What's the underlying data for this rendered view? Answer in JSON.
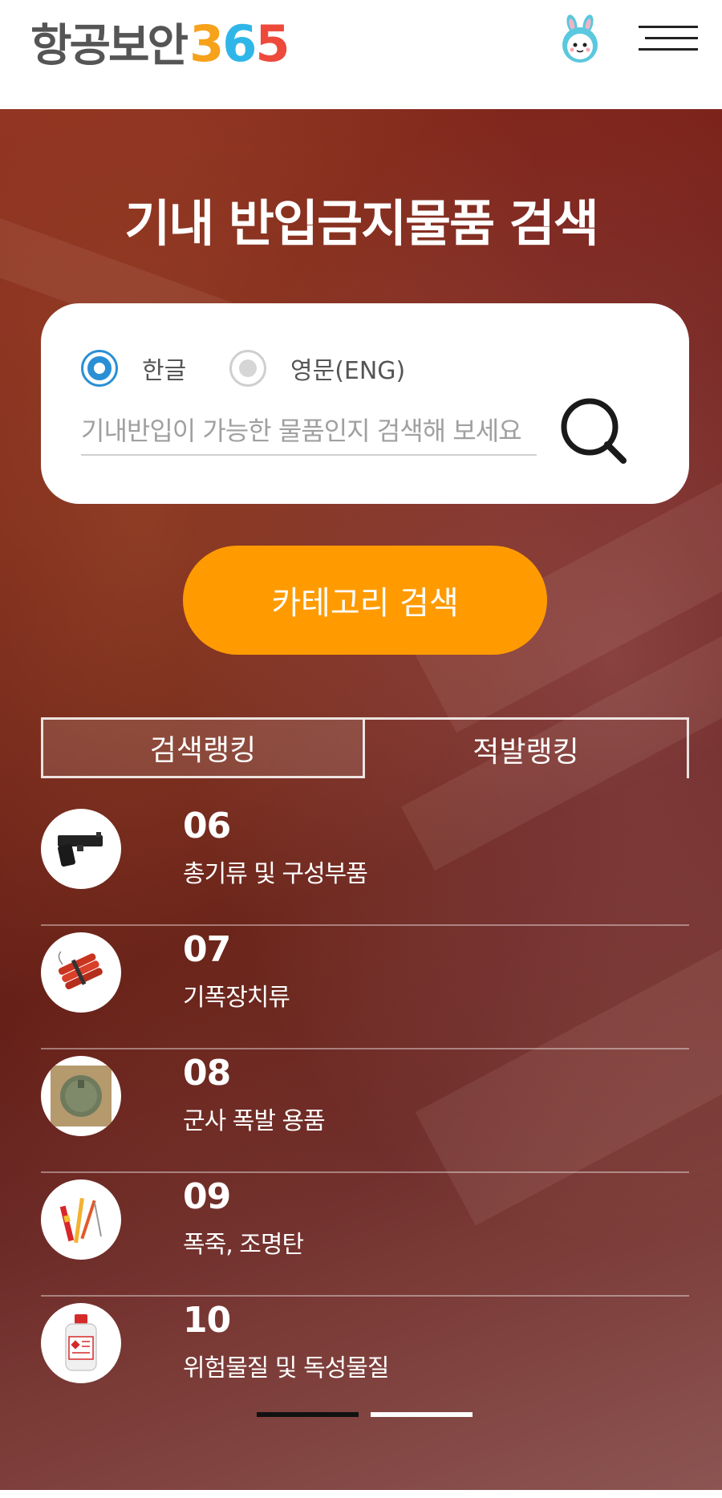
{
  "header": {
    "logo_text": "항공보안",
    "logo_number": [
      "3",
      "6",
      "5"
    ],
    "mascot_icon": "rabbit-mascot-icon",
    "menu_icon": "hamburger-menu-icon"
  },
  "hero": {
    "title": "기내 반입금지물품 검색"
  },
  "search": {
    "lang_options": [
      {
        "label": "한글",
        "selected": true
      },
      {
        "label": "영문(ENG)",
        "selected": false
      }
    ],
    "placeholder": "기내반입이 가능한 물품인지 검색해 보세요",
    "value": "",
    "search_icon": "search-icon"
  },
  "category_button": "카테고리 검색",
  "tabs": [
    {
      "label": "검색랭킹",
      "active": true
    },
    {
      "label": "적발랭킹",
      "active": false
    }
  ],
  "ranking": [
    {
      "rank": "06",
      "name": "총기류 및 구성부품",
      "icon": "pistol-icon"
    },
    {
      "rank": "07",
      "name": "기폭장치류",
      "icon": "dynamite-icon"
    },
    {
      "rank": "08",
      "name": "군사 폭발 용품",
      "icon": "landmine-icon"
    },
    {
      "rank": "09",
      "name": "폭죽, 조명탄",
      "icon": "firecracker-icon"
    },
    {
      "rank": "10",
      "name": "위험물질 및 독성물질",
      "icon": "chemical-bottle-icon"
    }
  ],
  "pagination": {
    "pages": 2,
    "current": 1
  },
  "colors": {
    "accent_orange": "#ff9b00",
    "radio_blue": "#2b8fd6",
    "logo_3": "#f7a21b",
    "logo_6": "#2fb6e8",
    "logo_5": "#ee4a3c"
  }
}
